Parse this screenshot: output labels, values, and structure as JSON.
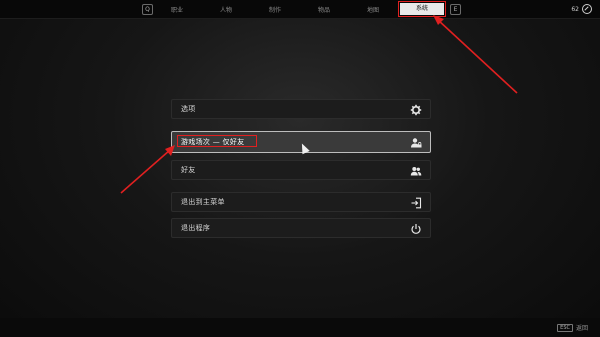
{
  "topbar": {
    "left_key": "Q",
    "right_key": "E",
    "tabs": [
      {
        "label": "职业"
      },
      {
        "label": "人物"
      },
      {
        "label": "制作"
      },
      {
        "label": "物品"
      },
      {
        "label": "地图"
      },
      {
        "label": "系统"
      }
    ],
    "counter": "62"
  },
  "menu": {
    "items": [
      {
        "label": "选项",
        "icon": "gear-icon"
      },
      {
        "label": "游戏场次 — 仅好友",
        "icon": "user-lock-icon"
      },
      {
        "label": "好友",
        "icon": "users-icon"
      },
      {
        "label": "退出到主菜单",
        "icon": "exit-door-icon"
      },
      {
        "label": "退出程序",
        "icon": "power-icon"
      }
    ]
  },
  "bottombar": {
    "key": "ESC",
    "label": "返回"
  },
  "colors": {
    "annotation": "#e02020",
    "background": "#101010"
  }
}
